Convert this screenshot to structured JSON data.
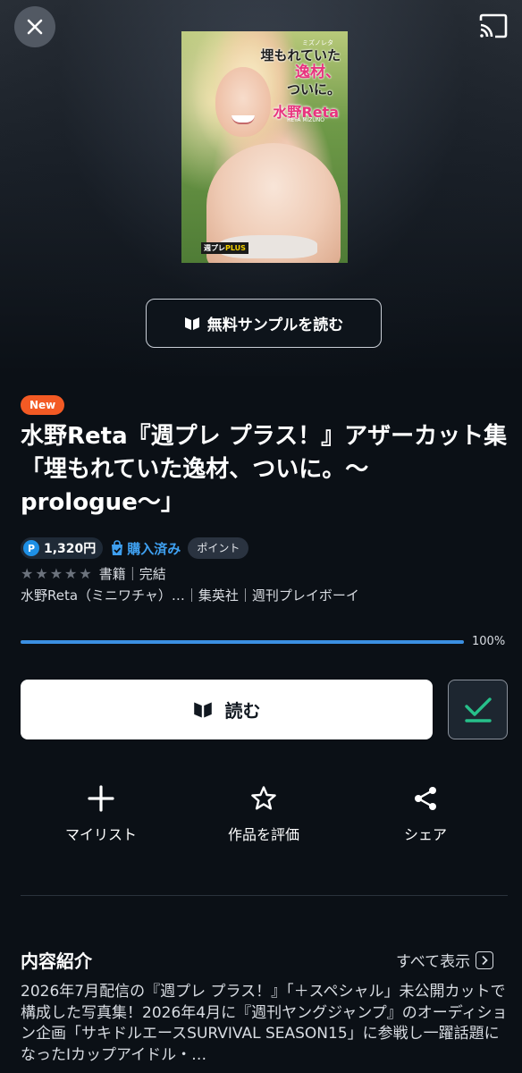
{
  "nav": {
    "close_icon": "close-icon",
    "cast_icon": "cast-icon"
  },
  "cover": {
    "small_title": "ミズノレタ",
    "headline_line1": "埋もれていた",
    "headline_line2": "逸材、",
    "headline_line3": "ついに。",
    "name": "水野Reta",
    "name_sub": "RETA MIZUNO",
    "logo_main": "週プレ",
    "logo_accent": "PLUS"
  },
  "sample_button": {
    "label": "無料サンプルを読む",
    "icon": "book-open-icon"
  },
  "book": {
    "badge": "New",
    "title": "水野Reta『週プレ プラス！』アザーカット集「埋もれていた逸材、ついに。〜prologue〜」",
    "price": "1,320円",
    "price_icon_letter": "P",
    "purchased_label": "購入済み",
    "point_label": "ポイント",
    "stars_filled": 0,
    "stars_total": 5,
    "category": "書籍｜完結",
    "authors": "水野Reta（ミニワチャ）…｜集英社｜週刊プレイボーイ"
  },
  "progress": {
    "value": 100,
    "text": "100%"
  },
  "read_button": {
    "label": "読む",
    "icon": "book-open-icon"
  },
  "done_button": {
    "icon": "check-icon",
    "color": "#27c08a"
  },
  "actions": [
    {
      "label": "マイリスト",
      "icon": "plus-icon"
    },
    {
      "label": "作品を評価",
      "icon": "star-outline-icon"
    },
    {
      "label": "シェア",
      "icon": "share-icon"
    }
  ],
  "about": {
    "title": "内容紹介",
    "see_all": "すべて表示",
    "text": "2026年7月配信の『週プレ プラス！』「＋スペシャル」未公開カットで構成した写真集！2026年4月に『週刊ヤングジャンプ』のオーディション企画「サキドルエースSURVIVAL SEASON15」に参戦し一躍話題になったIカップアイドル・…"
  },
  "colors": {
    "background": "#0b1016",
    "accent_blue": "#3b8fe2",
    "new_badge": "#f35a24",
    "check_green": "#27c08a"
  }
}
